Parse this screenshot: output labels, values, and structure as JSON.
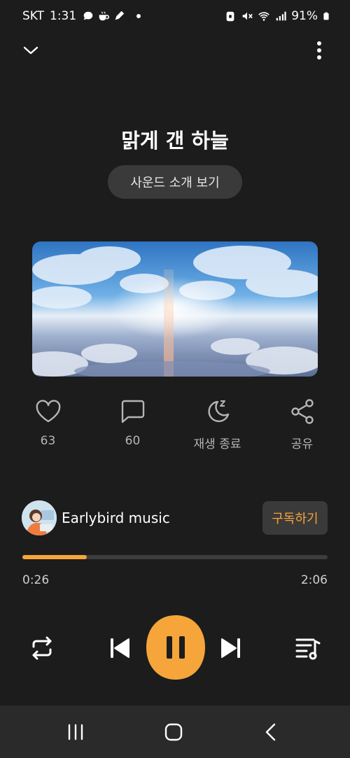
{
  "status_bar": {
    "carrier": "SKT",
    "time": "1:31",
    "battery": "91%",
    "notification_icons": [
      "chat-bubble-icon",
      "coffee-icon",
      "pen-icon",
      "dot-icon"
    ],
    "system_icons": [
      "vpn-icon",
      "mute-icon",
      "wifi-icon",
      "signal-icon",
      "battery-icon"
    ]
  },
  "header": {
    "collapse_icon": "chevron-down-icon",
    "more_icon": "more-vertical-icon"
  },
  "track": {
    "title": "맑게 갠 하늘",
    "intro_button": "사운드 소개 보기"
  },
  "actions": {
    "like": {
      "icon": "heart-icon",
      "label": "63"
    },
    "comment": {
      "icon": "comment-icon",
      "label": "60"
    },
    "sleep_timer": {
      "icon": "moon-icon",
      "label": "재생 종료"
    },
    "share": {
      "icon": "share-icon",
      "label": "공유"
    }
  },
  "channel": {
    "name": "Earlybird music",
    "subscribe": "구독하기"
  },
  "player": {
    "current_time": "0:26",
    "total_time": "2:06",
    "progress": 0.21,
    "state": "playing"
  },
  "colors": {
    "accent": "#f6a53a",
    "background": "#1c1c1c",
    "button_bg": "#3a3a3a"
  },
  "nav": {
    "recents_icon": "recents-icon",
    "home_icon": "home-icon",
    "back_icon": "back-icon"
  }
}
